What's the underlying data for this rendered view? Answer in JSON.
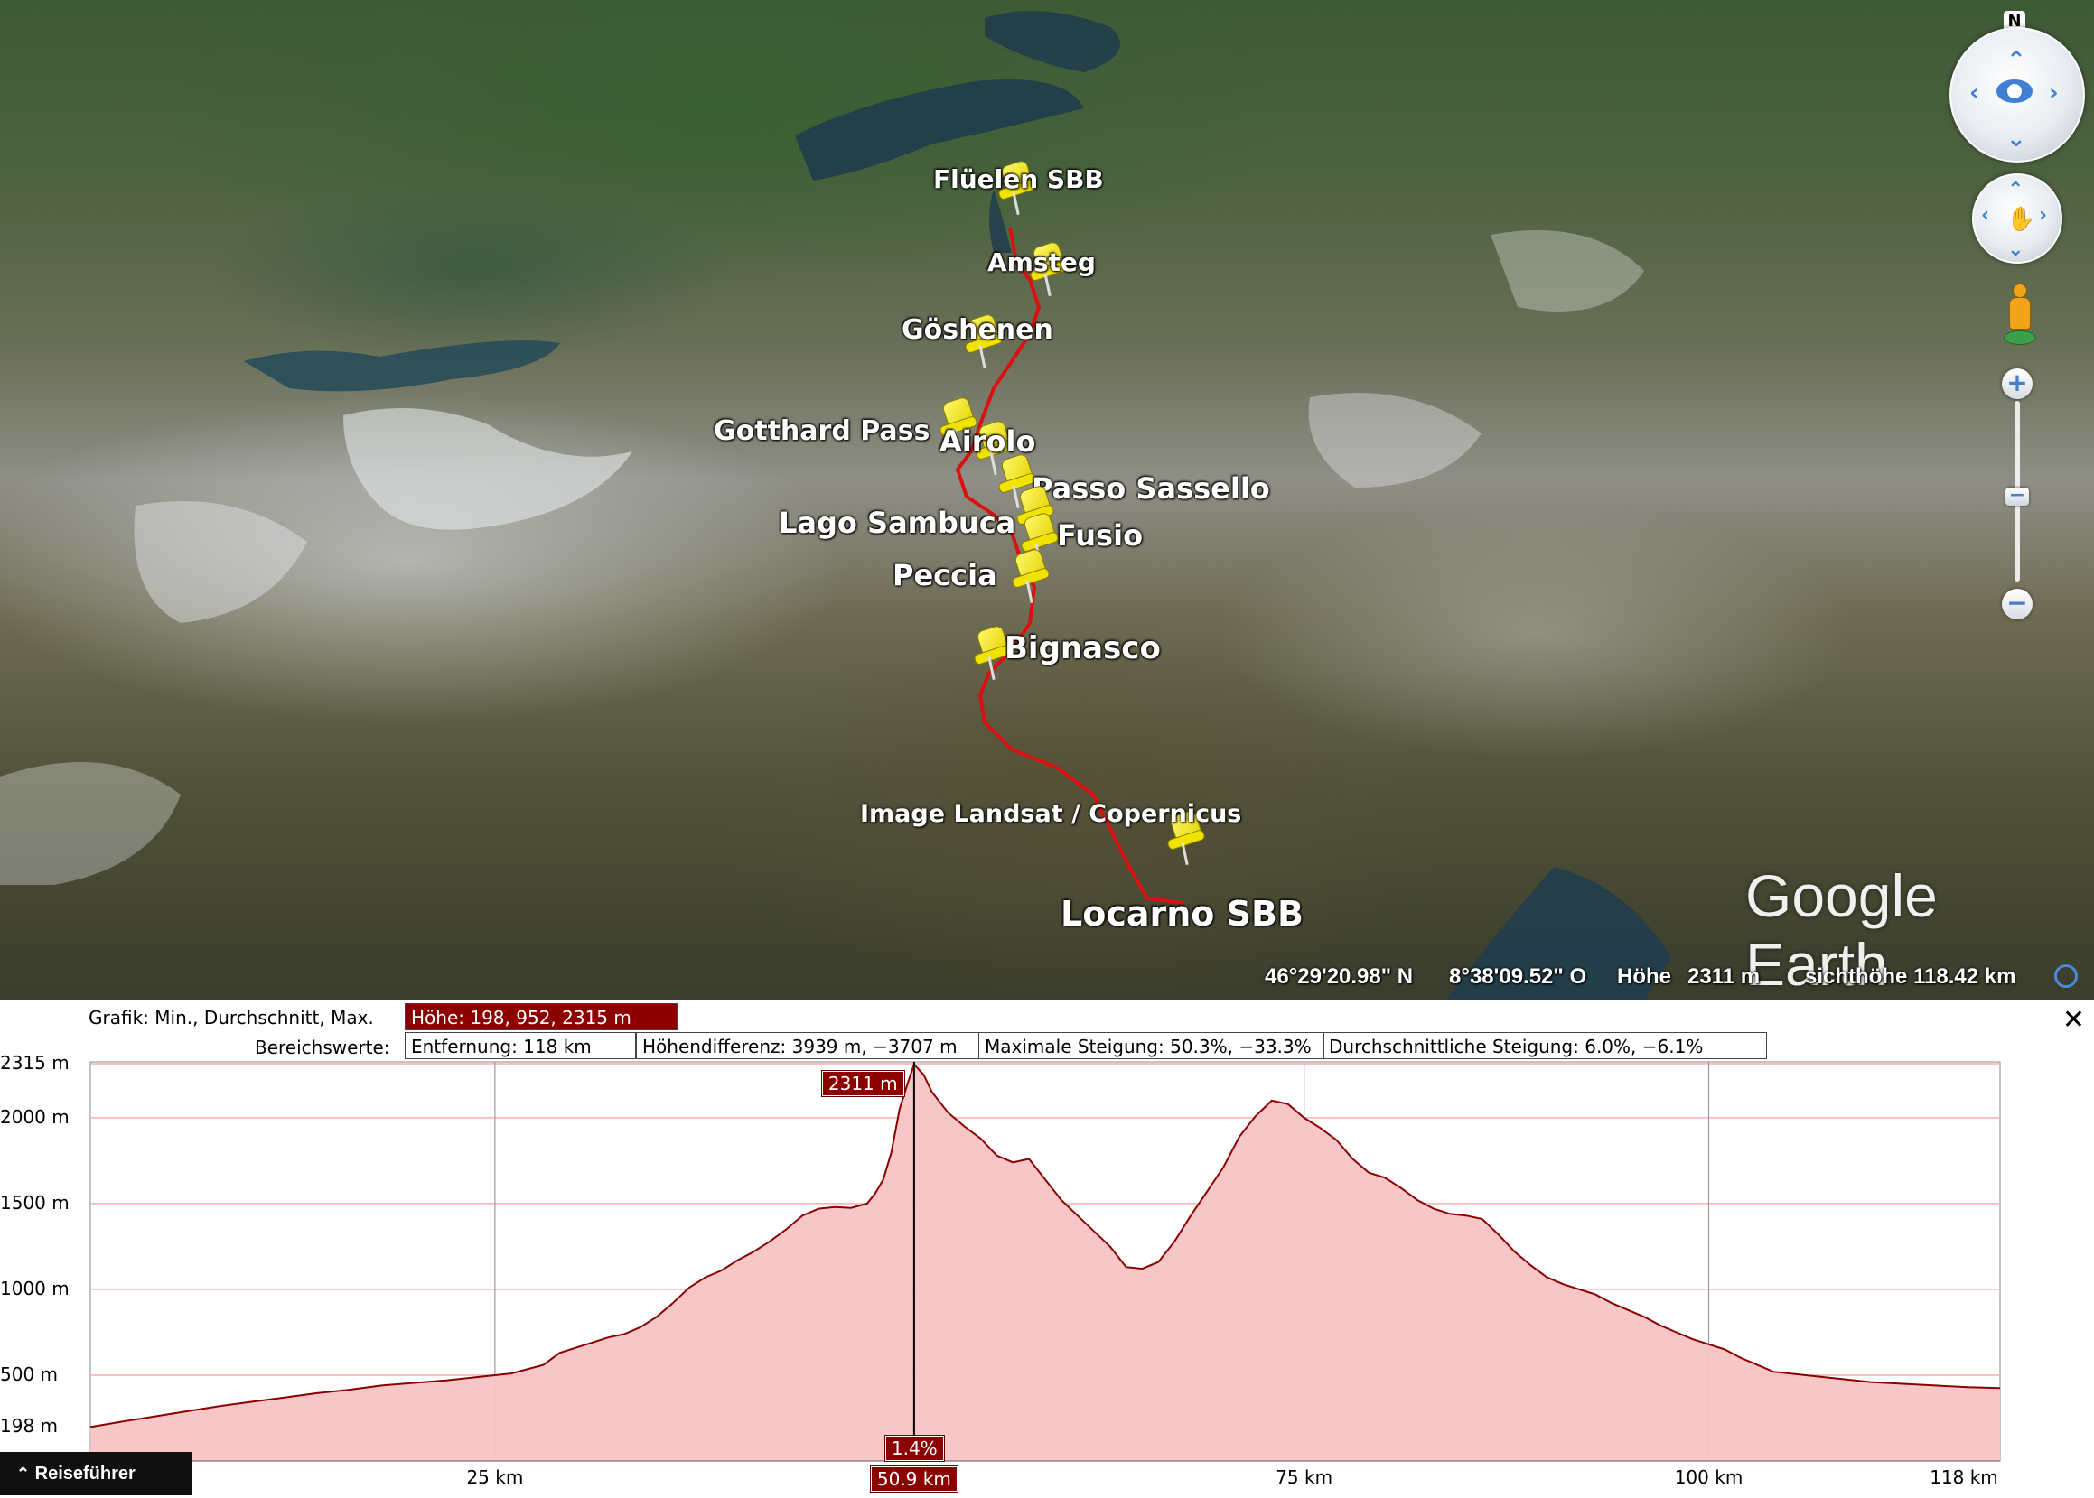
{
  "map": {
    "placemarks": [
      {
        "label": "Flüelen SBB"
      },
      {
        "label": "Amsteg"
      },
      {
        "label": "Göshenen"
      },
      {
        "label": "Gotthard Pass"
      },
      {
        "label": "Airolo"
      },
      {
        "label": "Passo Sassello"
      },
      {
        "label": "Lago Sambuca"
      },
      {
        "label": "Fusio"
      },
      {
        "label": "Peccia"
      },
      {
        "label": "Bignasco"
      },
      {
        "label": "Locarno SBB"
      }
    ],
    "attribution": "Image Landsat / Copernicus",
    "logo": "Google Earth",
    "status": {
      "lat": "46°29'20.98\" N",
      "lon": "8°38'09.52\" O",
      "elev_label": "Höhe",
      "elev_value": "2311 m",
      "eye_alt": "sichthöhe 118.42 km"
    },
    "compass_north": "N"
  },
  "profile": {
    "graph_label": "Grafik: Min., Durchschnitt, Max.",
    "graph_value": "Höhe: 198, 952, 2315 m",
    "range_label": "Bereichswerte:",
    "distance": "Entfernung: 118 km",
    "elev_diff": "Höhendifferenz: 3939 m, −3707 m",
    "max_slope": "Maximale Steigung: 50.3%, −33.3%",
    "avg_slope": "Durchschnittliche Steigung: 6.0%, −6.1%",
    "close": "✕",
    "cursor_elev": "2311 m",
    "cursor_slope": "1.4%",
    "cursor_dist": "50.9 km",
    "guide": "Reiseführer"
  },
  "chart_data": {
    "type": "area",
    "xlabel": "",
    "ylabel": "",
    "x_unit": "km",
    "y_unit": "m",
    "xlim": [
      0,
      118
    ],
    "ylim": [
      198,
      2315
    ],
    "ytick_labels": [
      "2315 m",
      "2000 m",
      "1500 m",
      "1000 m",
      "500 m",
      "198 m"
    ],
    "ytick_values": [
      2315,
      2000,
      1500,
      1000,
      500,
      198
    ],
    "xtick_labels": [
      "25 km",
      "75 km",
      "100 km",
      "118 km"
    ],
    "xtick_values": [
      25,
      75,
      100,
      118
    ],
    "cursor_x": 50.9,
    "fill_color": "#f7c4c4",
    "line_color": "#8b0000",
    "x": [
      0,
      2,
      4,
      6,
      8,
      10,
      12,
      14,
      16,
      18,
      20,
      22,
      24,
      26,
      28,
      29,
      30,
      31,
      32,
      33,
      34,
      35,
      36,
      37,
      38,
      39,
      40,
      41,
      42,
      43,
      44,
      45,
      46,
      47,
      48,
      48.5,
      49,
      49.5,
      50,
      50.5,
      50.9,
      51.5,
      52,
      53,
      54,
      55,
      56,
      57,
      58,
      59,
      60,
      61,
      62,
      63,
      64,
      65,
      66,
      67,
      68,
      69,
      70,
      71,
      72,
      73,
      74,
      75,
      76,
      77,
      78,
      79,
      80,
      81,
      82,
      83,
      84,
      85,
      86,
      87,
      88,
      89,
      90,
      91,
      92,
      93,
      94,
      95,
      96,
      97,
      98,
      99,
      100,
      101,
      102,
      103,
      104,
      106,
      108,
      110,
      112,
      114,
      116,
      118
    ],
    "y": [
      198,
      230,
      260,
      290,
      320,
      345,
      370,
      395,
      415,
      440,
      455,
      470,
      490,
      510,
      560,
      630,
      660,
      690,
      720,
      740,
      780,
      840,
      920,
      1010,
      1070,
      1110,
      1170,
      1220,
      1280,
      1350,
      1430,
      1470,
      1480,
      1475,
      1500,
      1560,
      1640,
      1800,
      2050,
      2200,
      2311,
      2250,
      2150,
      2030,
      1950,
      1880,
      1780,
      1740,
      1760,
      1640,
      1520,
      1430,
      1340,
      1250,
      1130,
      1120,
      1160,
      1280,
      1430,
      1570,
      1710,
      1890,
      2010,
      2100,
      2080,
      2000,
      1940,
      1870,
      1760,
      1680,
      1650,
      1590,
      1520,
      1470,
      1440,
      1430,
      1410,
      1320,
      1220,
      1140,
      1070,
      1030,
      1000,
      970,
      920,
      880,
      840,
      790,
      750,
      710,
      680,
      650,
      600,
      560,
      520,
      500,
      480,
      460,
      450,
      440,
      430,
      425
    ]
  }
}
